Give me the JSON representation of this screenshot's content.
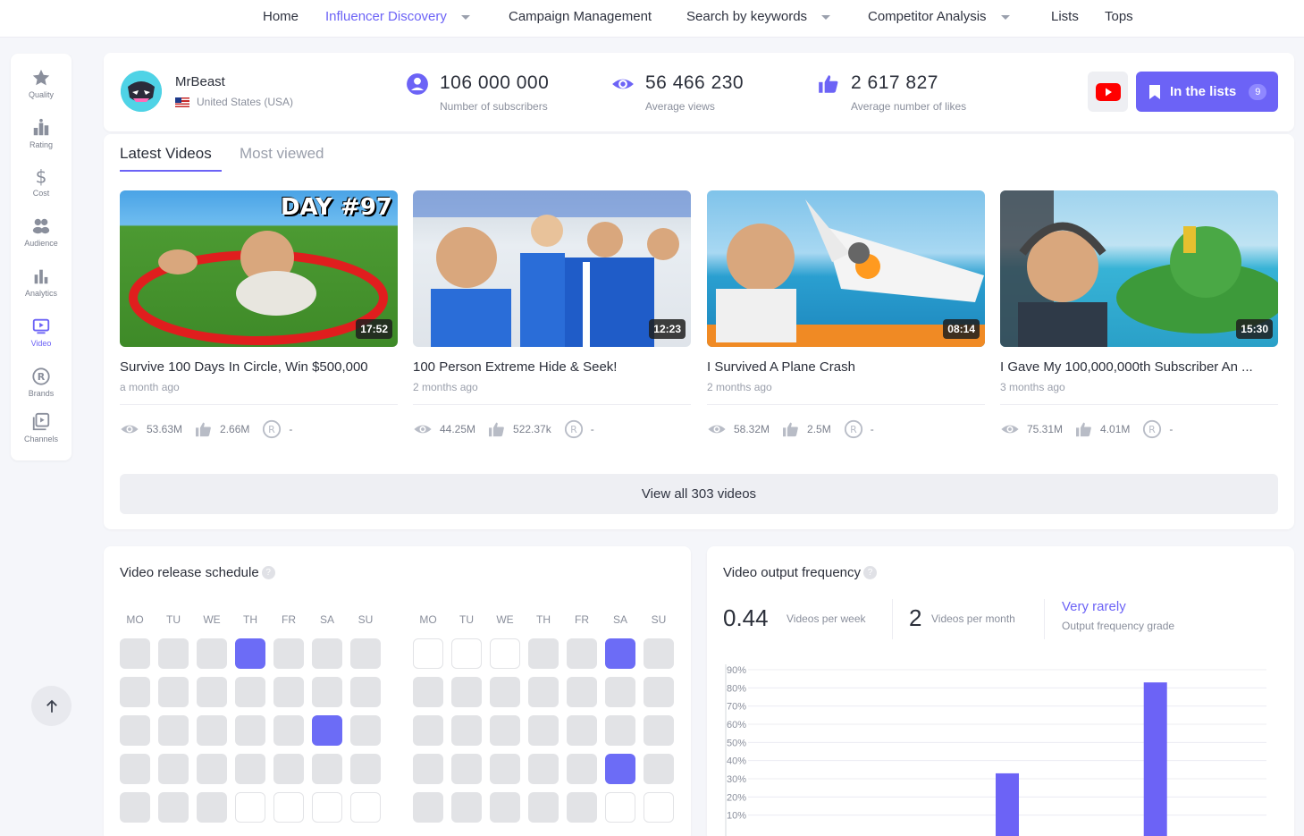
{
  "nav": {
    "home": "Home",
    "influencer_discovery": "Influencer Discovery",
    "campaign_management": "Campaign Management",
    "search_by_keywords": "Search by keywords",
    "competitor_analysis": "Competitor Analysis",
    "lists": "Lists",
    "tops": "Tops"
  },
  "sidebar": {
    "items": [
      {
        "label": "Quality",
        "icon": "star-icon"
      },
      {
        "label": "Rating",
        "icon": "rating-icon"
      },
      {
        "label": "Cost",
        "icon": "dollar-icon"
      },
      {
        "label": "Audience",
        "icon": "audience-icon"
      },
      {
        "label": "Analytics",
        "icon": "bar-chart-icon"
      },
      {
        "label": "Video",
        "icon": "video-icon"
      },
      {
        "label": "Brands",
        "icon": "registered-icon"
      },
      {
        "label": "Channels",
        "icon": "channels-icon"
      }
    ],
    "active": "Video"
  },
  "profile": {
    "name": "MrBeast",
    "country": "United States (USA)",
    "subscribers": {
      "value": "106 000 000",
      "label": "Number of subscribers"
    },
    "views": {
      "value": "56 466 230",
      "label": "Average views"
    },
    "likes": {
      "value": "2 617 827",
      "label": "Average number of likes"
    },
    "lists_button": "In the lists",
    "lists_count": "9"
  },
  "videos": {
    "tabs": [
      "Latest Videos",
      "Most viewed"
    ],
    "active_tab": "Latest Videos",
    "items": [
      {
        "title": "Survive 100 Days In Circle, Win $500,000",
        "age": "a month ago",
        "duration": "17:52",
        "views": "53.63M",
        "likes": "2.66M",
        "brand": "-",
        "overlay": "DAY #97"
      },
      {
        "title": "100 Person Extreme Hide & Seek!",
        "age": "2 months ago",
        "duration": "12:23",
        "views": "44.25M",
        "likes": "522.37k",
        "brand": "-"
      },
      {
        "title": "I Survived A Plane Crash",
        "age": "2 months ago",
        "duration": "08:14",
        "views": "58.32M",
        "likes": "2.5M",
        "brand": "-"
      },
      {
        "title": "I Gave My 100,000,000th Subscriber An ...",
        "age": "3 months ago",
        "duration": "15:30",
        "views": "75.31M",
        "likes": "4.01M",
        "brand": "-"
      }
    ],
    "view_all": "View all 303 videos"
  },
  "schedule": {
    "title": "Video release schedule",
    "days": [
      "MO",
      "TU",
      "WE",
      "TH",
      "FR",
      "SA",
      "SU"
    ],
    "month1": [
      [
        "off",
        "off",
        "off",
        "on",
        "off",
        "off",
        "off"
      ],
      [
        "off",
        "off",
        "off",
        "off",
        "off",
        "off",
        "off"
      ],
      [
        "off",
        "off",
        "off",
        "off",
        "off",
        "on",
        "off"
      ],
      [
        "off",
        "off",
        "off",
        "off",
        "off",
        "off",
        "off"
      ],
      [
        "off",
        "off",
        "off",
        "empty",
        "empty",
        "empty",
        "empty"
      ]
    ],
    "month2": [
      [
        "empty",
        "empty",
        "empty",
        "off",
        "off",
        "on",
        "off"
      ],
      [
        "off",
        "off",
        "off",
        "off",
        "off",
        "off",
        "off"
      ],
      [
        "off",
        "off",
        "off",
        "off",
        "off",
        "off",
        "off"
      ],
      [
        "off",
        "off",
        "off",
        "off",
        "off",
        "on",
        "off"
      ],
      [
        "off",
        "off",
        "off",
        "off",
        "off",
        "empty",
        "empty"
      ]
    ]
  },
  "frequency": {
    "title": "Video output frequency",
    "per_week_value": "0.44",
    "per_week_label": "Videos per week",
    "per_month_value": "2",
    "per_month_label": "Videos per month",
    "grade": "Very rarely",
    "grade_label": "Output frequency grade",
    "accent": "#6c63f6"
  },
  "chart_data": {
    "type": "bar",
    "categories": [
      "",
      "",
      "",
      "",
      "",
      "",
      ""
    ],
    "values": [
      0,
      0,
      0,
      33,
      0,
      83,
      0
    ],
    "ylim": [
      0,
      90
    ],
    "yticks": [
      "10%",
      "20%",
      "30%",
      "40%",
      "50%",
      "60%",
      "70%",
      "80%",
      "90%"
    ],
    "xlabel": "",
    "ylabel": "",
    "grid": true
  }
}
